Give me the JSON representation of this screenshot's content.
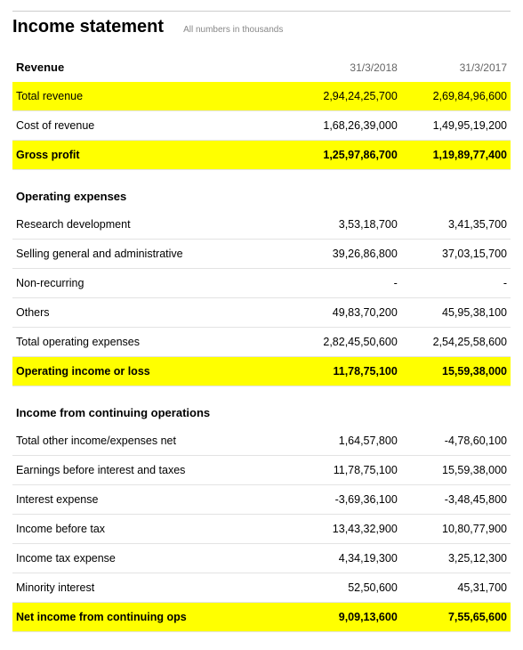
{
  "header": {
    "title": "Income statement",
    "subtitle": "All numbers in thousands"
  },
  "columns": [
    "31/3/2018",
    "31/3/2017"
  ],
  "sections": {
    "revenue": {
      "heading": "Revenue",
      "total_revenue": {
        "label": "Total revenue",
        "v": [
          "2,94,24,25,700",
          "2,69,84,96,600"
        ]
      },
      "cost_of_revenue": {
        "label": "Cost of revenue",
        "v": [
          "1,68,26,39,000",
          "1,49,95,19,200"
        ]
      },
      "gross_profit": {
        "label": "Gross profit",
        "v": [
          "1,25,97,86,700",
          "1,19,89,77,400"
        ]
      }
    },
    "opex": {
      "heading": "Operating expenses",
      "rnd": {
        "label": "Research development",
        "v": [
          "3,53,18,700",
          "3,41,35,700"
        ]
      },
      "sga": {
        "label": "Selling general and administrative",
        "v": [
          "39,26,86,800",
          "37,03,15,700"
        ]
      },
      "non_recurring": {
        "label": "Non-recurring",
        "v": [
          "-",
          "-"
        ]
      },
      "others": {
        "label": "Others",
        "v": [
          "49,83,70,200",
          "45,95,38,100"
        ]
      },
      "total_opex": {
        "label": "Total operating expenses",
        "v": [
          "2,82,45,50,600",
          "2,54,25,58,600"
        ]
      },
      "op_income": {
        "label": "Operating income or loss",
        "v": [
          "11,78,75,100",
          "15,59,38,000"
        ]
      }
    },
    "contops": {
      "heading": "Income from continuing operations",
      "other_income": {
        "label": "Total other income/expenses net",
        "v": [
          "1,64,57,800",
          "-4,78,60,100"
        ]
      },
      "ebit": {
        "label": "Earnings before interest and taxes",
        "v": [
          "11,78,75,100",
          "15,59,38,000"
        ]
      },
      "interest_exp": {
        "label": "Interest expense",
        "v": [
          "-3,69,36,100",
          "-3,48,45,800"
        ]
      },
      "income_before_tax": {
        "label": "Income before tax",
        "v": [
          "13,43,32,900",
          "10,80,77,900"
        ]
      },
      "tax_exp": {
        "label": "Income tax expense",
        "v": [
          "4,34,19,300",
          "3,25,12,300"
        ]
      },
      "minority": {
        "label": "Minority interest",
        "v": [
          "52,50,600",
          "45,31,700"
        ]
      },
      "net_income": {
        "label": "Net income from continuing ops",
        "v": [
          "9,09,13,600",
          "7,55,65,600"
        ]
      }
    }
  }
}
